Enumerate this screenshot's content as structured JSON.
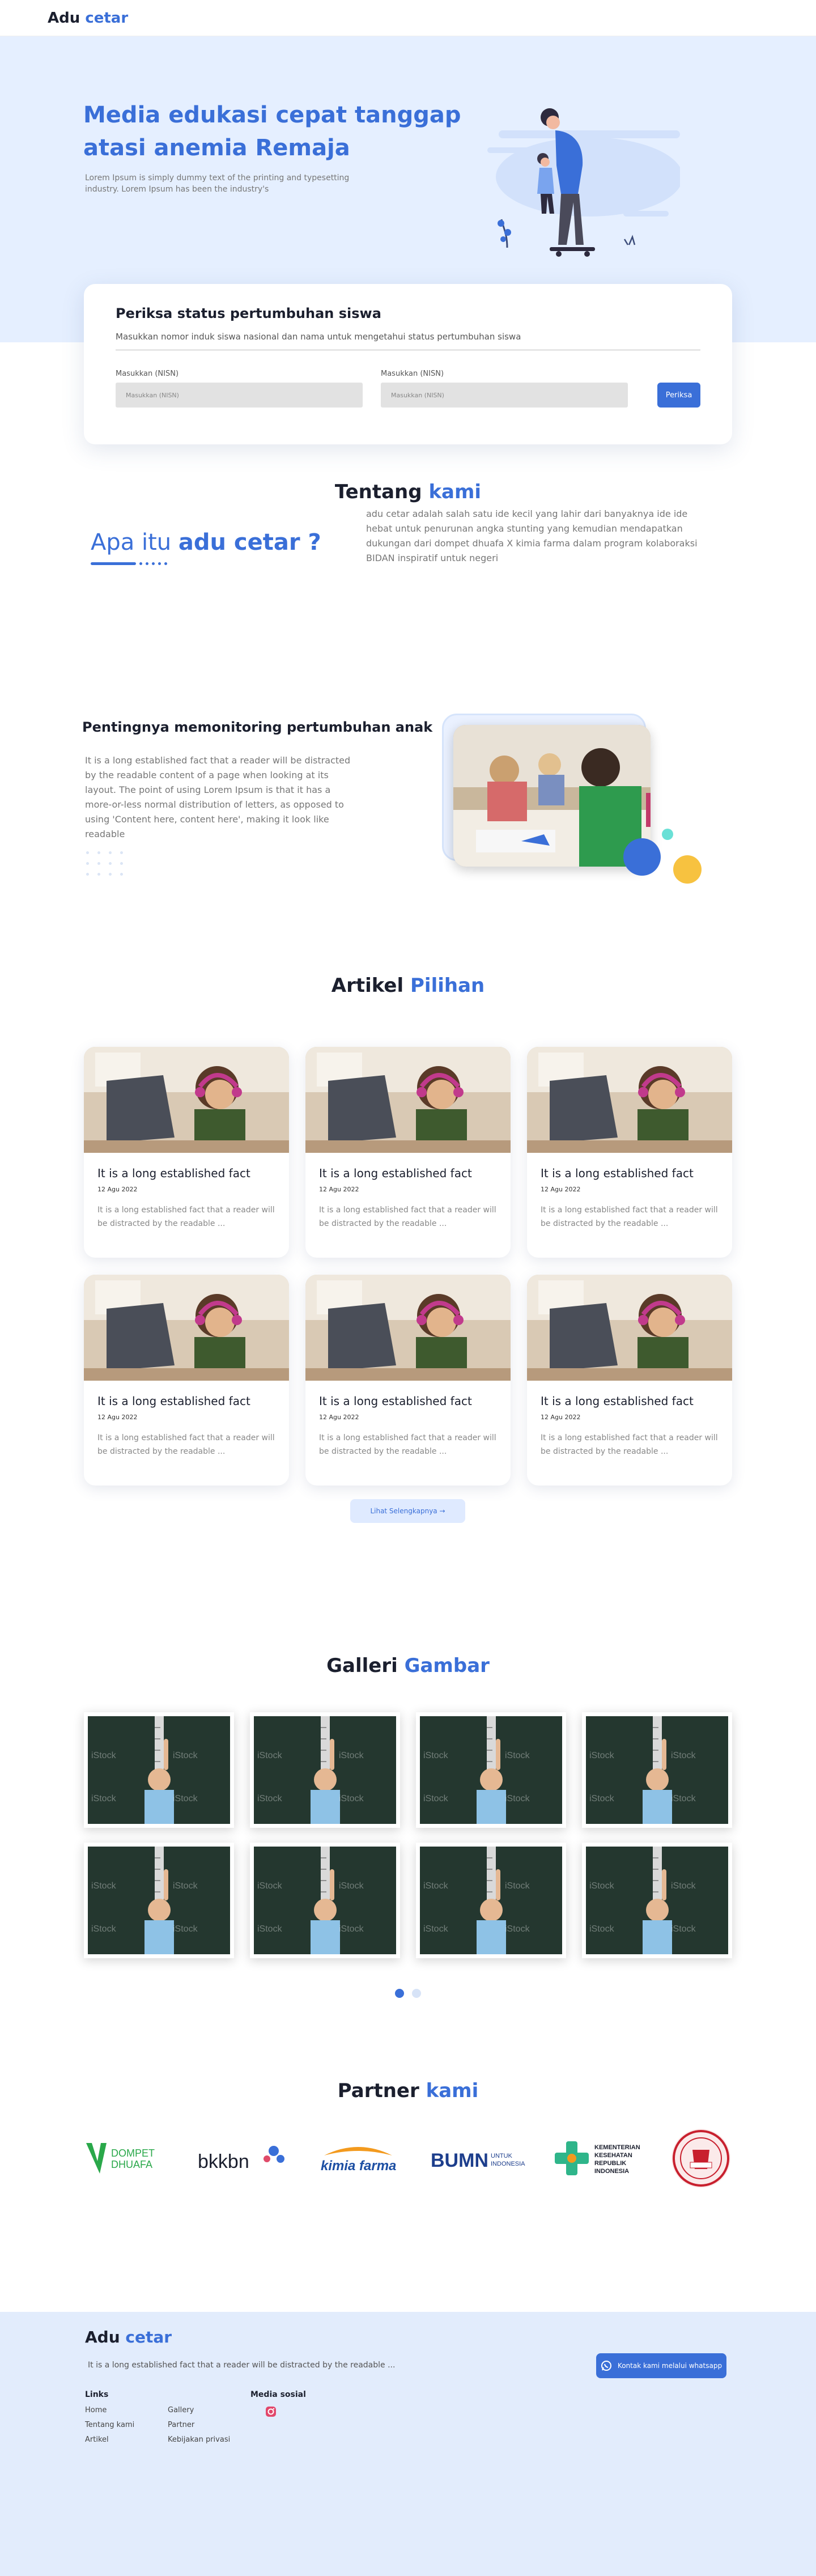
{
  "header": {
    "brand_part1": "Adu",
    "brand_part2": "cetar"
  },
  "hero": {
    "title_line1": "Media edukasi cepat tanggap",
    "title_line2": "atasi anemia Remaja",
    "subtitle": "Lorem Ipsum is simply dummy text of the printing and typesetting industry. Lorem Ipsum has been the industry's"
  },
  "check": {
    "title": "Periksa status pertumbuhan siswa",
    "description": "Masukkan nomor induk siswa nasional dan nama untuk mengetahui status pertumbuhan siswa",
    "field1_label": "Masukkan (NISN)",
    "field1_placeholder": "Masukkan (NISN)",
    "field2_label": "Masukkan (NISN)",
    "field2_placeholder": "Masukkan (NISN)",
    "button_label": "Periksa"
  },
  "about": {
    "title_part1": "Tentang",
    "title_part2": "kami",
    "heading_part1": "Apa itu",
    "heading_part2": "adu cetar ?",
    "text": "adu cetar adalah salah satu ide kecil yang lahir dari banyaknya ide ide hebat untuk penurunan angka stunting yang kemudian mendapatkan dukungan dari dompet dhuafa X kimia farma dalam program kolaboraksi BIDAN inspiratif untuk negeri"
  },
  "monitoring": {
    "title": "Pentingnya memonitoring pertumbuhan anak",
    "text": "It is a long established fact that a reader will be distracted by the readable content of a page when looking at its layout. The point of using Lorem Ipsum is that it has a more-or-less normal distribution of letters, as opposed to using 'Content here, content here', making it look like readable"
  },
  "articles": {
    "title_part1": "Artikel",
    "title_part2": "Pilihan",
    "items": [
      {
        "title": "It is a long established fact",
        "date": "12 Agu 2022",
        "excerpt": "It is a long established fact that a reader will be distracted by the readable ..."
      },
      {
        "title": "It is a long established fact",
        "date": "12 Agu 2022",
        "excerpt": "It is a long established fact that a reader will be distracted by the readable ..."
      },
      {
        "title": "It is a long established fact",
        "date": "12 Agu 2022",
        "excerpt": "It is a long established fact that a reader will be distracted by the readable ..."
      },
      {
        "title": "It is a long established fact",
        "date": "12 Agu 2022",
        "excerpt": "It is a long established fact that a reader will be distracted by the readable ..."
      },
      {
        "title": "It is a long established fact",
        "date": "12 Agu 2022",
        "excerpt": "It is a long established fact that a reader will be distracted by the readable ..."
      },
      {
        "title": "It is a long established fact",
        "date": "12 Agu 2022",
        "excerpt": "It is a long established fact that a reader will be distracted by the readable ..."
      }
    ],
    "more_button": "Lihat Selengkapnya",
    "more_icon": "arrow-right-icon"
  },
  "gallery": {
    "title_part1": "Galleri",
    "title_part2": "Gambar",
    "watermark": "iStock",
    "pagination": {
      "current": 1,
      "total": 2
    }
  },
  "partners": {
    "title_part1": "Partner",
    "title_part2": "kami",
    "items": [
      {
        "name": "dompet-dhuafa",
        "line1": "DOMPET",
        "line2": "DHUAFA"
      },
      {
        "name": "bkkbn",
        "text": "bkkbn"
      },
      {
        "name": "kimia-farma",
        "text": "kimia farma"
      },
      {
        "name": "bumn",
        "text": "BUMN",
        "sub1": "UNTUK",
        "sub2": "INDONESIA"
      },
      {
        "name": "kemenkes",
        "lines": [
          "KEMENTERIAN",
          "KESEHATAN",
          "REPUBLIK",
          "INDONESIA"
        ]
      },
      {
        "name": "seal",
        "text": ""
      }
    ]
  },
  "footer": {
    "brand_part1": "Adu",
    "brand_part2": "cetar",
    "tagline": "It is a long established fact that a reader will be distracted by the readable ...",
    "wa_button": "Kontak kami melalui whatsapp",
    "links_title": "Links",
    "links_col1": [
      "Home",
      "Tentang kami",
      "Artikel"
    ],
    "links_col2": [
      "Gallery",
      "Partner",
      "Kebijakan privasi"
    ],
    "social_title": "Media sosial",
    "social_icon": "instagram-icon"
  },
  "colors": {
    "accent": "#3a6fd8",
    "hero_bg": "#e5efff",
    "footer_bg": "#e2ecfc"
  }
}
